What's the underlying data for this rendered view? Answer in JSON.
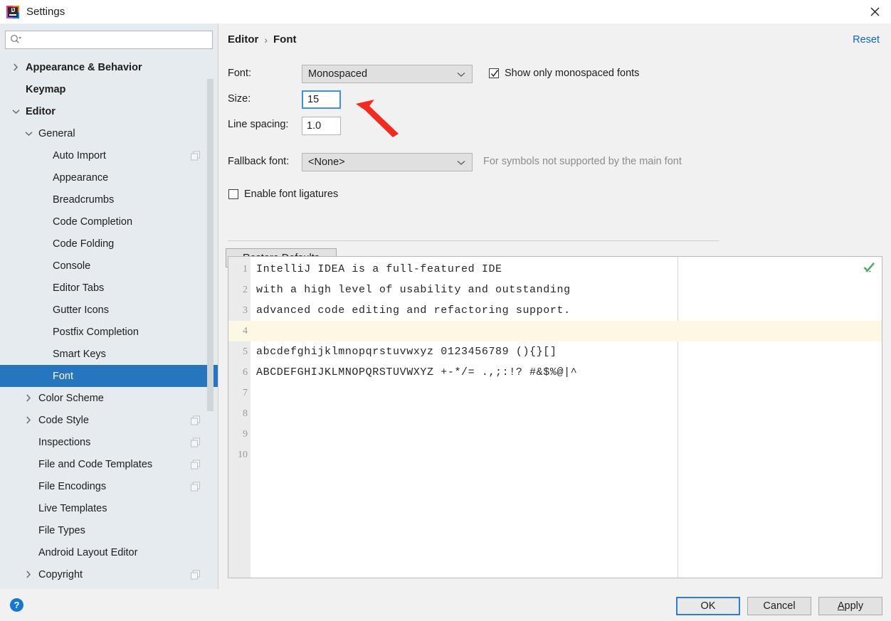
{
  "window": {
    "title": "Settings",
    "app_icon": "intellij-idea-icon",
    "close_icon": "close-icon"
  },
  "sidebar": {
    "search": {
      "placeholder": "",
      "value": "",
      "icon": "search-icon"
    },
    "items": [
      {
        "label": "Appearance & Behavior",
        "indent": 0,
        "arrow": "right",
        "bold": true,
        "badge": false,
        "selected": false
      },
      {
        "label": "Keymap",
        "indent": 0,
        "arrow": "none",
        "bold": true,
        "badge": false,
        "selected": false
      },
      {
        "label": "Editor",
        "indent": 0,
        "arrow": "down",
        "bold": true,
        "badge": false,
        "selected": false
      },
      {
        "label": "General",
        "indent": 1,
        "arrow": "down",
        "bold": false,
        "badge": false,
        "selected": false
      },
      {
        "label": "Auto Import",
        "indent": 2,
        "arrow": "none",
        "bold": false,
        "badge": true,
        "selected": false
      },
      {
        "label": "Appearance",
        "indent": 2,
        "arrow": "none",
        "bold": false,
        "badge": false,
        "selected": false
      },
      {
        "label": "Breadcrumbs",
        "indent": 2,
        "arrow": "none",
        "bold": false,
        "badge": false,
        "selected": false
      },
      {
        "label": "Code Completion",
        "indent": 2,
        "arrow": "none",
        "bold": false,
        "badge": false,
        "selected": false
      },
      {
        "label": "Code Folding",
        "indent": 2,
        "arrow": "none",
        "bold": false,
        "badge": false,
        "selected": false
      },
      {
        "label": "Console",
        "indent": 2,
        "arrow": "none",
        "bold": false,
        "badge": false,
        "selected": false
      },
      {
        "label": "Editor Tabs",
        "indent": 2,
        "arrow": "none",
        "bold": false,
        "badge": false,
        "selected": false
      },
      {
        "label": "Gutter Icons",
        "indent": 2,
        "arrow": "none",
        "bold": false,
        "badge": false,
        "selected": false
      },
      {
        "label": "Postfix Completion",
        "indent": 2,
        "arrow": "none",
        "bold": false,
        "badge": false,
        "selected": false
      },
      {
        "label": "Smart Keys",
        "indent": 2,
        "arrow": "none",
        "bold": false,
        "badge": false,
        "selected": false
      },
      {
        "label": "Font",
        "indent": 2,
        "arrow": "none",
        "bold": false,
        "badge": false,
        "selected": true
      },
      {
        "label": "Color Scheme",
        "indent": 1,
        "arrow": "right",
        "bold": false,
        "badge": false,
        "selected": false
      },
      {
        "label": "Code Style",
        "indent": 1,
        "arrow": "right",
        "bold": false,
        "badge": true,
        "selected": false
      },
      {
        "label": "Inspections",
        "indent": 1,
        "arrow": "none",
        "bold": false,
        "badge": true,
        "selected": false
      },
      {
        "label": "File and Code Templates",
        "indent": 1,
        "arrow": "none",
        "bold": false,
        "badge": true,
        "selected": false
      },
      {
        "label": "File Encodings",
        "indent": 1,
        "arrow": "none",
        "bold": false,
        "badge": true,
        "selected": false
      },
      {
        "label": "Live Templates",
        "indent": 1,
        "arrow": "none",
        "bold": false,
        "badge": false,
        "selected": false
      },
      {
        "label": "File Types",
        "indent": 1,
        "arrow": "none",
        "bold": false,
        "badge": false,
        "selected": false
      },
      {
        "label": "Android Layout Editor",
        "indent": 1,
        "arrow": "none",
        "bold": false,
        "badge": false,
        "selected": false
      },
      {
        "label": "Copyright",
        "indent": 1,
        "arrow": "right",
        "bold": false,
        "badge": true,
        "selected": false
      }
    ]
  },
  "content": {
    "breadcrumb": {
      "parent": "Editor",
      "separator": "›",
      "current": "Font"
    },
    "reset_label": "Reset",
    "font": {
      "label": "Font:",
      "value": "Monospaced",
      "dropdown_icon": "chevron-down-icon"
    },
    "show_monospaced": {
      "label": "Show only monospaced fonts",
      "checked": true
    },
    "size": {
      "label": "Size:",
      "value": "15",
      "focused": true
    },
    "line_spacing": {
      "label": "Line spacing:",
      "value": "1.0"
    },
    "fallback_font": {
      "label": "Fallback font:",
      "value": "<None>",
      "hint": "For symbols not supported by the main font",
      "dropdown_icon": "chevron-down-icon"
    },
    "ligatures": {
      "label": "Enable font ligatures",
      "checked": false
    },
    "restore_defaults_label": "Restore Defaults",
    "preview": {
      "status_icon": "green-checkmark-icon",
      "lines": [
        {
          "num": "1",
          "text": "IntelliJ IDEA is a full-featured IDE",
          "highlight": false
        },
        {
          "num": "2",
          "text": "with a high level of usability and outstanding",
          "highlight": false
        },
        {
          "num": "3",
          "text": "advanced code editing and refactoring support.",
          "highlight": false
        },
        {
          "num": "4",
          "text": "",
          "highlight": true
        },
        {
          "num": "5",
          "text": "abcdefghijklmnopqrstuvwxyz 0123456789 (){}[]",
          "highlight": false
        },
        {
          "num": "6",
          "text": "ABCDEFGHIJKLMNOPQRSTUVWXYZ +-*/= .,;:!? #&$%@|^",
          "highlight": false
        },
        {
          "num": "7",
          "text": "",
          "highlight": false
        },
        {
          "num": "8",
          "text": "",
          "highlight": false
        },
        {
          "num": "9",
          "text": "",
          "highlight": false
        },
        {
          "num": "10",
          "text": "",
          "highlight": false
        }
      ]
    }
  },
  "footer": {
    "help_label": "?",
    "ok_label": "OK",
    "cancel_label": "Cancel",
    "apply_label": "Apply",
    "apply_mnemonic": "A",
    "apply_rest": "pply"
  },
  "annotation": {
    "arrow_color": "#f22a22",
    "arrow_name": "red-pointer-arrow"
  },
  "colors": {
    "selection_blue": "#2675bf",
    "link_blue": "#0d67c4",
    "sidebar_bg": "#e6ebef",
    "panel_bg": "#f1f1f1",
    "highlight_line": "#fcf8e3"
  }
}
